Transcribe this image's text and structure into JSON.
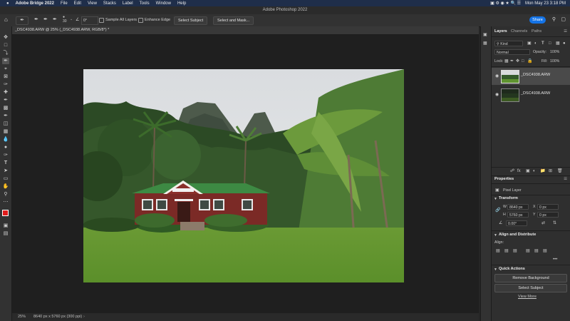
{
  "menubar": {
    "apple": "",
    "app_name": "Adobe Bridge 2022",
    "items": [
      "File",
      "Edit",
      "View",
      "Stacks",
      "Label",
      "Tools",
      "Window",
      "Help"
    ],
    "datetime": "Mon May 23  3:18 PM"
  },
  "window": {
    "title": "Adobe Photoshop 2022"
  },
  "options": {
    "brush_size": "30",
    "angle": "0°",
    "sample_all_layers": "Sample All Layers",
    "enhance_edge": "Enhance Edge",
    "select_subject": "Select Subject",
    "select_and_mask": "Select and Mask...",
    "share": "Share"
  },
  "document": {
    "tab_title": "_DSC4938.ARW @ 25% (_DSC4938.ARW, RGB/8*) *",
    "zoom": "25%",
    "dimensions": "8640 px x 5760 px (300 ppi)"
  },
  "layers_panel": {
    "tabs": [
      "Layers",
      "Channels",
      "Paths"
    ],
    "kind": "Kind",
    "blend_mode": "Normal",
    "opacity_label": "Opacity:",
    "opacity": "100%",
    "lock_label": "Lock:",
    "fill_label": "Fill:",
    "fill": "100%",
    "layers": [
      {
        "name": "_DSC4938.ARW",
        "selected": true
      },
      {
        "name": "_DSC4938.ARW",
        "selected": false
      }
    ]
  },
  "properties": {
    "title": "Properties",
    "layer_type": "Pixel Layer",
    "transform_title": "Transform",
    "w_label": "W",
    "w": "8640 px",
    "h_label": "H",
    "h": "5760 px",
    "x_label": "X",
    "x": "0 px",
    "y_label": "Y",
    "y": "0 px",
    "angle": "0.00°",
    "align_title": "Align and Distribute",
    "align_label": "Align:",
    "more": "•••",
    "quick_actions_title": "Quick Actions",
    "remove_background": "Remove Background",
    "select_subject": "Select Subject",
    "view_more": "View More"
  },
  "colors": {
    "accent": "#1473e6",
    "foreground": "#e01b1b",
    "background": "#ffffff"
  }
}
